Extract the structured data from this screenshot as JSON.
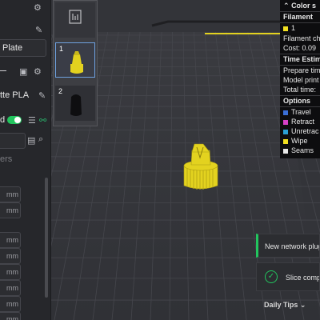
{
  "sidebar": {
    "plate_label": "Plate",
    "filament_label": "tte PLA",
    "toggle_label": "d",
    "section_label": "ers",
    "units": [
      "mm",
      "mm",
      "mm",
      "mm",
      "mm",
      "mm",
      "mm",
      "mm"
    ]
  },
  "plates": [
    {
      "number": "1",
      "selected": true
    },
    {
      "number": "2",
      "selected": false
    }
  ],
  "legend": {
    "title": "Color s",
    "filament_header": "Filament",
    "filament_index": "1",
    "filament_change": "Filament ch",
    "cost": "Cost:  0.09",
    "time_header": "Time Estim",
    "prepare": "Prepare tim",
    "model_print": "Model print",
    "total": "Total time:",
    "options_header": "Options",
    "options": [
      {
        "label": "Travel",
        "color": "#3a6fd8"
      },
      {
        "label": "Retract",
        "color": "#d640c8"
      },
      {
        "label": "Unretrac",
        "color": "#2aa0d6"
      },
      {
        "label": "Wipe",
        "color": "#f2e021"
      },
      {
        "label": "Seams",
        "color": "#e8e8e8"
      }
    ],
    "filament_color": "#f2e021"
  },
  "notifications": {
    "network_plugin": "New network plug",
    "slice_complete": "Slice comp"
  },
  "tips": {
    "label": "Daily Tips"
  },
  "colors": {
    "accent_green": "#22c55e",
    "model_yellow": "#e3d21f"
  }
}
